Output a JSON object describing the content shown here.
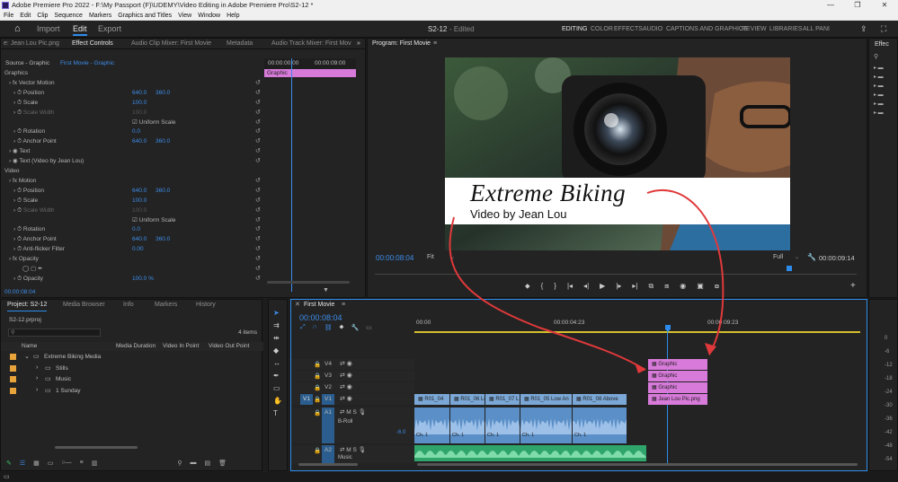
{
  "window": {
    "title": "Adobe Premiere Pro 2022 - F:\\My Passport (F)\\UDEMY\\Video Editing in Adobe Premiere Pro\\S2-12 *",
    "controls": [
      "—",
      "❐",
      "✕"
    ]
  },
  "menu": [
    "File",
    "Edit",
    "Clip",
    "Sequence",
    "Markers",
    "Graphics and Titles",
    "View",
    "Window",
    "Help"
  ],
  "header": {
    "home_icon": "home-icon",
    "tabs": [
      "Import",
      "Edit",
      "Export"
    ],
    "active_tab": "Edit",
    "project_title": "S2-12",
    "project_status": "- Edited",
    "workspaces": [
      "EDITING",
      "COLOR",
      "EFFECTS",
      "AUDIO",
      "CAPTIONS AND GRAPHICS",
      "REVIEW",
      "LIBRARIES",
      "ALL PANI"
    ]
  },
  "source_panel": {
    "tabs": [
      "e: Jean Lou Pic.png",
      "Effect Controls",
      "Audio Clip Mixer: First Movie",
      "Metadata",
      "Audio Track Mixer: First Mov"
    ],
    "active_tab": "Effect Controls",
    "source_label": "Source - Graphic",
    "target_label": "First Movie - Graphic",
    "mini_timecodes": [
      "00:00:00:00",
      "00:00:09:00"
    ],
    "clip_label": "Graphic",
    "rows": [
      {
        "label": "Graphics",
        "indent": 0
      },
      {
        "label": "Vector Motion",
        "indent": 1,
        "fx": true
      },
      {
        "label": "Position",
        "indent": 2,
        "v1": "640.0",
        "v2": "360.0"
      },
      {
        "label": "Scale",
        "indent": 2,
        "v1": "100.0"
      },
      {
        "label": "Scale Width",
        "indent": 2,
        "v1": "100.0",
        "dim": true
      },
      {
        "label": "Uniform Scale",
        "indent": 5,
        "checkbox": true
      },
      {
        "label": "Rotation",
        "indent": 2,
        "v1": "0.0"
      },
      {
        "label": "Anchor Point",
        "indent": 2,
        "v1": "640.0",
        "v2": "360.0"
      },
      {
        "label": "Text",
        "indent": 1,
        "eye": true
      },
      {
        "label": "Text (Video by Jean Lou)",
        "indent": 1,
        "eye": true
      },
      {
        "label": "Video",
        "indent": 0
      },
      {
        "label": "Motion",
        "indent": 1,
        "fx": true
      },
      {
        "label": "Position",
        "indent": 2,
        "v1": "640.0",
        "v2": "360.0"
      },
      {
        "label": "Scale",
        "indent": 2,
        "v1": "100.0"
      },
      {
        "label": "Scale Width",
        "indent": 2,
        "v1": "100.0",
        "dim": true
      },
      {
        "label": "Uniform Scale",
        "indent": 5,
        "checkbox": true
      },
      {
        "label": "Rotation",
        "indent": 2,
        "v1": "0.0"
      },
      {
        "label": "Anchor Point",
        "indent": 2,
        "v1": "640.0",
        "v2": "360.0"
      },
      {
        "label": "Anti-flicker Filter",
        "indent": 2,
        "v1": "0.00"
      },
      {
        "label": "Opacity",
        "indent": 1,
        "fx": true
      },
      {
        "label": "",
        "indent": 2,
        "masks": true
      },
      {
        "label": "Opacity",
        "indent": 2,
        "v1": "100.0 %"
      }
    ],
    "timecode": "00:00:08:04"
  },
  "program_panel": {
    "title": "Program: First Movie",
    "title_text": "Extreme Biking",
    "subtitle_text": "Video by Jean Lou",
    "timecode": "00:00:08:04",
    "fit": "Fit",
    "quality": "Full",
    "duration": "00:00:09:14"
  },
  "project_panel": {
    "tabs": [
      "Project: S2-12",
      "Media Browser",
      "Info",
      "Markers",
      "History"
    ],
    "active_tab": "Project: S2-12",
    "file": "S2-12.prproj",
    "item_count": "4 items",
    "columns": [
      "Name",
      "Media Duration",
      "Video In Point",
      "Video Out Point"
    ],
    "items": [
      {
        "name": "Extreme Biking Media",
        "level": 0,
        "color": "#e8a43a"
      },
      {
        "name": "Stills",
        "level": 1,
        "color": "#e8a43a"
      },
      {
        "name": "Music",
        "level": 1,
        "color": "#e8a43a"
      },
      {
        "name": "1 Sunday",
        "level": 1,
        "color": "#e8a43a"
      }
    ]
  },
  "timeline": {
    "tab": "First Movie",
    "timecode": "00:00:08:04",
    "ruler": [
      "00:00",
      "00:00:04:23",
      "00:00:09:23"
    ],
    "tracks": [
      "V4",
      "V3",
      "V2",
      "V1",
      "A1",
      "A2"
    ],
    "track_a1_name": "B-Roll",
    "track_a1_db": "-6.0",
    "track_a2_name": "Music",
    "source_patch_v": "V1",
    "graphics": [
      {
        "label": "Graphic",
        "track": "V4"
      },
      {
        "label": "Graphic",
        "track": "V3"
      },
      {
        "label": "Graphic",
        "track": "V2"
      },
      {
        "label": "Jean Lou Pic.png",
        "track": "V1"
      }
    ],
    "v1_clips": [
      "R01_04",
      "R01_06 Lo",
      "R01_07 L",
      "R01_05 Low An",
      "R01_08 Above"
    ],
    "audio_labels": [
      "Ch. 1",
      "Ch. 1",
      "Ch. 1",
      "Ch. 1",
      "Ch. 1"
    ]
  },
  "meters": [
    "0",
    "-6",
    "-12",
    "-18",
    "-24",
    "-30",
    "-36",
    "-42",
    "-48",
    "-54"
  ],
  "right_panel": {
    "title": "Effec"
  },
  "colors": {
    "accent": "#2d8ceb",
    "graphic_clip": "#d77ad9",
    "video_clip": "#7aa7d6",
    "audio_clip": "#2fa56c",
    "arrow": "#e0393b"
  }
}
